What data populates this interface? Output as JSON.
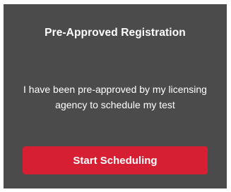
{
  "card": {
    "title": "Pre-Approved Registration",
    "description": "I have been pre-approved by my licensing agency to schedule my test",
    "button_label": "Start Scheduling"
  },
  "colors": {
    "card_background": "#4b4b4b",
    "button_background": "#d61f33",
    "text": "#ffffff"
  }
}
